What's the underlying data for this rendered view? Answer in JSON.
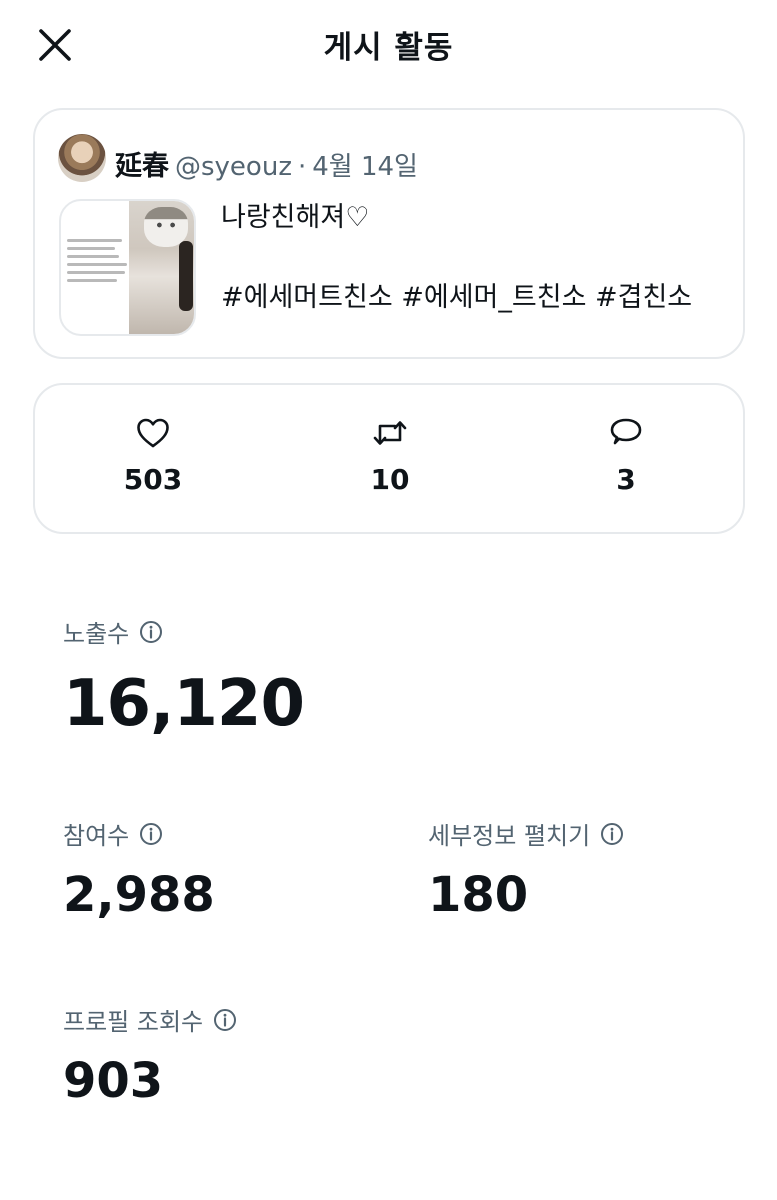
{
  "header": {
    "title": "게시 활동",
    "close_icon": "close-icon"
  },
  "post": {
    "author_name": "延春",
    "author_handle": "@syeouz",
    "separator": "·",
    "date": "4월 14일",
    "text_line1": "나랑친해져♡",
    "text_line2": "#에세머트친소 #에세머_트친소 #겹친소"
  },
  "engagement": {
    "likes": {
      "icon": "heart-icon",
      "count": "503"
    },
    "reposts": {
      "icon": "repost-icon",
      "count": "10"
    },
    "replies": {
      "icon": "reply-icon",
      "count": "3"
    }
  },
  "metrics": {
    "impressions": {
      "label": "노출수",
      "value": "16,120"
    },
    "engagements": {
      "label": "참여수",
      "value": "2,988"
    },
    "detail_expands": {
      "label": "세부정보 펼치기",
      "value": "180"
    },
    "profile_visits": {
      "label": "프로필 조회수",
      "value": "903"
    }
  },
  "colors": {
    "text_primary": "#0f1419",
    "text_secondary": "#536471",
    "border": "#e6e9ec"
  }
}
